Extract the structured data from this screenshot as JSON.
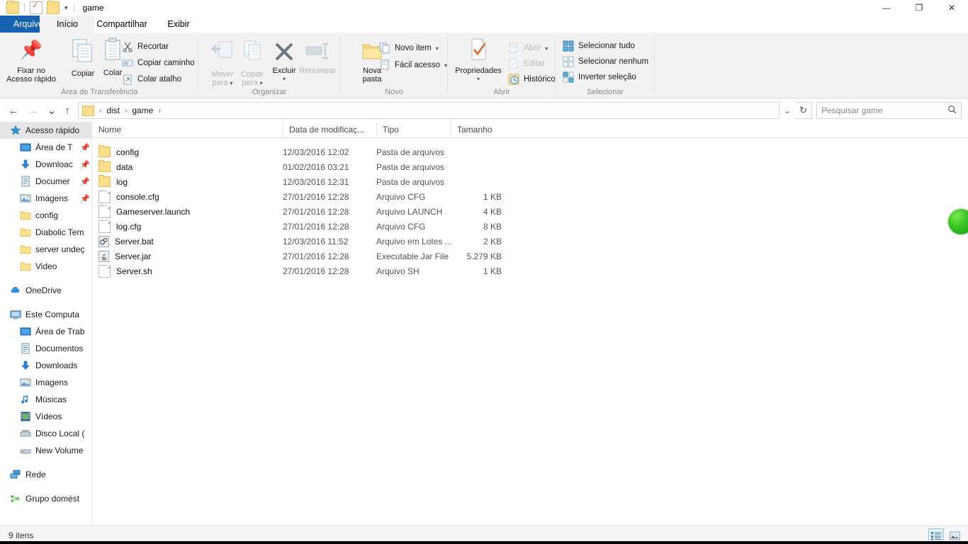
{
  "window": {
    "title": "game",
    "quick_access_icons": [
      "folder-icon",
      "properties-icon",
      "new-folder-icon"
    ],
    "quick_access_caret": "▾",
    "controls": {
      "minimize": "—",
      "maximize": "❐",
      "close": "✕"
    },
    "ribbon_collapse": "⌃",
    "help": "?"
  },
  "tabs": [
    {
      "label": "Arquivo",
      "kind": "file"
    },
    {
      "label": "Início",
      "kind": "active"
    },
    {
      "label": "Compartilhar",
      "kind": "normal"
    },
    {
      "label": "Exibir",
      "kind": "normal"
    }
  ],
  "ribbon": {
    "groups": [
      {
        "name": "Área de Transferência"
      },
      {
        "name": "Organizar"
      },
      {
        "name": "Novo"
      },
      {
        "name": "Abrir"
      },
      {
        "name": "Selecionar"
      }
    ],
    "clipboard": {
      "pin_line1": "Fixar no",
      "pin_line2": "Acesso rápido",
      "copy": "Copiar",
      "paste": "Colar",
      "cut": "Recortar",
      "copy_path": "Copiar caminho",
      "paste_shortcut": "Colar atalho"
    },
    "organize": {
      "move_to_line1": "Mover",
      "move_to_line2": "para",
      "copy_to_line1": "Copiar",
      "copy_to_line2": "para",
      "delete": "Excluir",
      "rename": "Renomear",
      "caret": "▾"
    },
    "new": {
      "new_folder_line1": "Nova",
      "new_folder_line2": "pasta",
      "new_item": "Novo item",
      "easy_access": "Fácil acesso",
      "caret": "▾"
    },
    "open": {
      "properties": "Propriedades",
      "open": "Abrir",
      "edit": "Editar",
      "history": "Histórico",
      "caret": "▾"
    },
    "select": {
      "select_all": "Selecionar tudo",
      "select_none": "Selecionar nenhum",
      "invert": "Inverter seleção"
    }
  },
  "addressbar": {
    "back": "←",
    "forward": "→",
    "recent": "⌄",
    "up": "↑",
    "breadcrumbs": [
      "dist",
      "game"
    ],
    "breadcrumb_sep": "›",
    "dropdown": "⌄",
    "refresh": "↻",
    "search_placeholder": "Pesquisar game",
    "search_value": "",
    "search_icon": "search-icon"
  },
  "sidebar": {
    "sections": [
      {
        "header": {
          "label": "Acesso rápido",
          "icon": "star-icon",
          "selected": true
        },
        "items": [
          {
            "label": "Área de T",
            "icon": "desktop-icon",
            "pinned": true
          },
          {
            "label": "Downloac",
            "icon": "download-icon",
            "pinned": true
          },
          {
            "label": "Documer",
            "icon": "documents-icon",
            "pinned": true
          },
          {
            "label": "Imagens",
            "icon": "pictures-icon",
            "pinned": true
          },
          {
            "label": "config",
            "icon": "folder-icon",
            "pinned": false
          },
          {
            "label": "Diabolic Tem",
            "icon": "folder-icon",
            "pinned": false
          },
          {
            "label": "server undeç",
            "icon": "folder-icon",
            "pinned": false
          },
          {
            "label": "Video",
            "icon": "folder-icon",
            "pinned": false
          }
        ]
      },
      {
        "header": {
          "label": "OneDrive",
          "icon": "cloud-icon",
          "selected": false
        },
        "items": []
      },
      {
        "header": {
          "label": "Este Computa",
          "icon": "computer-icon",
          "selected": false
        },
        "items": [
          {
            "label": "Área de Trab",
            "icon": "desktop-icon",
            "pinned": false
          },
          {
            "label": "Documentos",
            "icon": "documents-icon",
            "pinned": false
          },
          {
            "label": "Downloads",
            "icon": "download-icon",
            "pinned": false
          },
          {
            "label": "Imagens",
            "icon": "pictures-icon",
            "pinned": false
          },
          {
            "label": "Músicas",
            "icon": "music-icon",
            "pinned": false
          },
          {
            "label": "Vídeos",
            "icon": "video-icon",
            "pinned": false
          },
          {
            "label": "Disco Local (",
            "icon": "drive-icon",
            "pinned": false
          },
          {
            "label": "New Volume",
            "icon": "drive-icon",
            "pinned": false
          }
        ]
      },
      {
        "header": {
          "label": "Rede",
          "icon": "network-icon",
          "selected": false
        },
        "items": []
      },
      {
        "header": {
          "label": "Grupo domést",
          "icon": "homegroup-icon",
          "selected": false
        },
        "items": []
      }
    ]
  },
  "filelist": {
    "columns": [
      {
        "label": "Nome",
        "key": "name"
      },
      {
        "label": "Data de modificaç...",
        "key": "date"
      },
      {
        "label": "Tipo",
        "key": "type"
      },
      {
        "label": "Tamanho",
        "key": "size"
      }
    ],
    "sort_indicator": "⌃",
    "rows": [
      {
        "name": "config",
        "date": "12/03/2016 12:02",
        "type": "Pasta de arquivos",
        "size": "",
        "icon": "folder-icon"
      },
      {
        "name": "data",
        "date": "01/02/2016 03:21",
        "type": "Pasta de arquivos",
        "size": "",
        "icon": "folder-icon"
      },
      {
        "name": "log",
        "date": "12/03/2016 12:31",
        "type": "Pasta de arquivos",
        "size": "",
        "icon": "folder-icon"
      },
      {
        "name": "console.cfg",
        "date": "27/01/2016 12:28",
        "type": "Arquivo CFG",
        "size": "1 KB",
        "icon": "file-icon"
      },
      {
        "name": "Gameserver.launch",
        "date": "27/01/2016 12:28",
        "type": "Arquivo LAUNCH",
        "size": "4 KB",
        "icon": "file-icon"
      },
      {
        "name": "log.cfg",
        "date": "27/01/2016 12:28",
        "type": "Arquivo CFG",
        "size": "8 KB",
        "icon": "file-icon"
      },
      {
        "name": "Server.bat",
        "date": "12/03/2016 11:52",
        "type": "Arquivo em Lotes ...",
        "size": "2 KB",
        "icon": "batch-icon"
      },
      {
        "name": "Server.jar",
        "date": "27/01/2016 12:28",
        "type": "Executable Jar File",
        "size": "5.279 KB",
        "icon": "java-icon"
      },
      {
        "name": "Server.sh",
        "date": "27/01/2016 12:28",
        "type": "Arquivo SH",
        "size": "1 KB",
        "icon": "file-icon"
      }
    ]
  },
  "statusbar": {
    "item_count": "9 itens",
    "views": [
      {
        "name": "details-view",
        "active": true
      },
      {
        "name": "large-icons-view",
        "active": false
      }
    ]
  },
  "overlay": {
    "ball": "green-ball"
  },
  "colors": {
    "tab_accent": "#1661b0",
    "ribbon_bg": "#f2f2f2",
    "folder": "#fcdf8d",
    "selection": "#e5e5e5",
    "ball": "#34c224"
  }
}
